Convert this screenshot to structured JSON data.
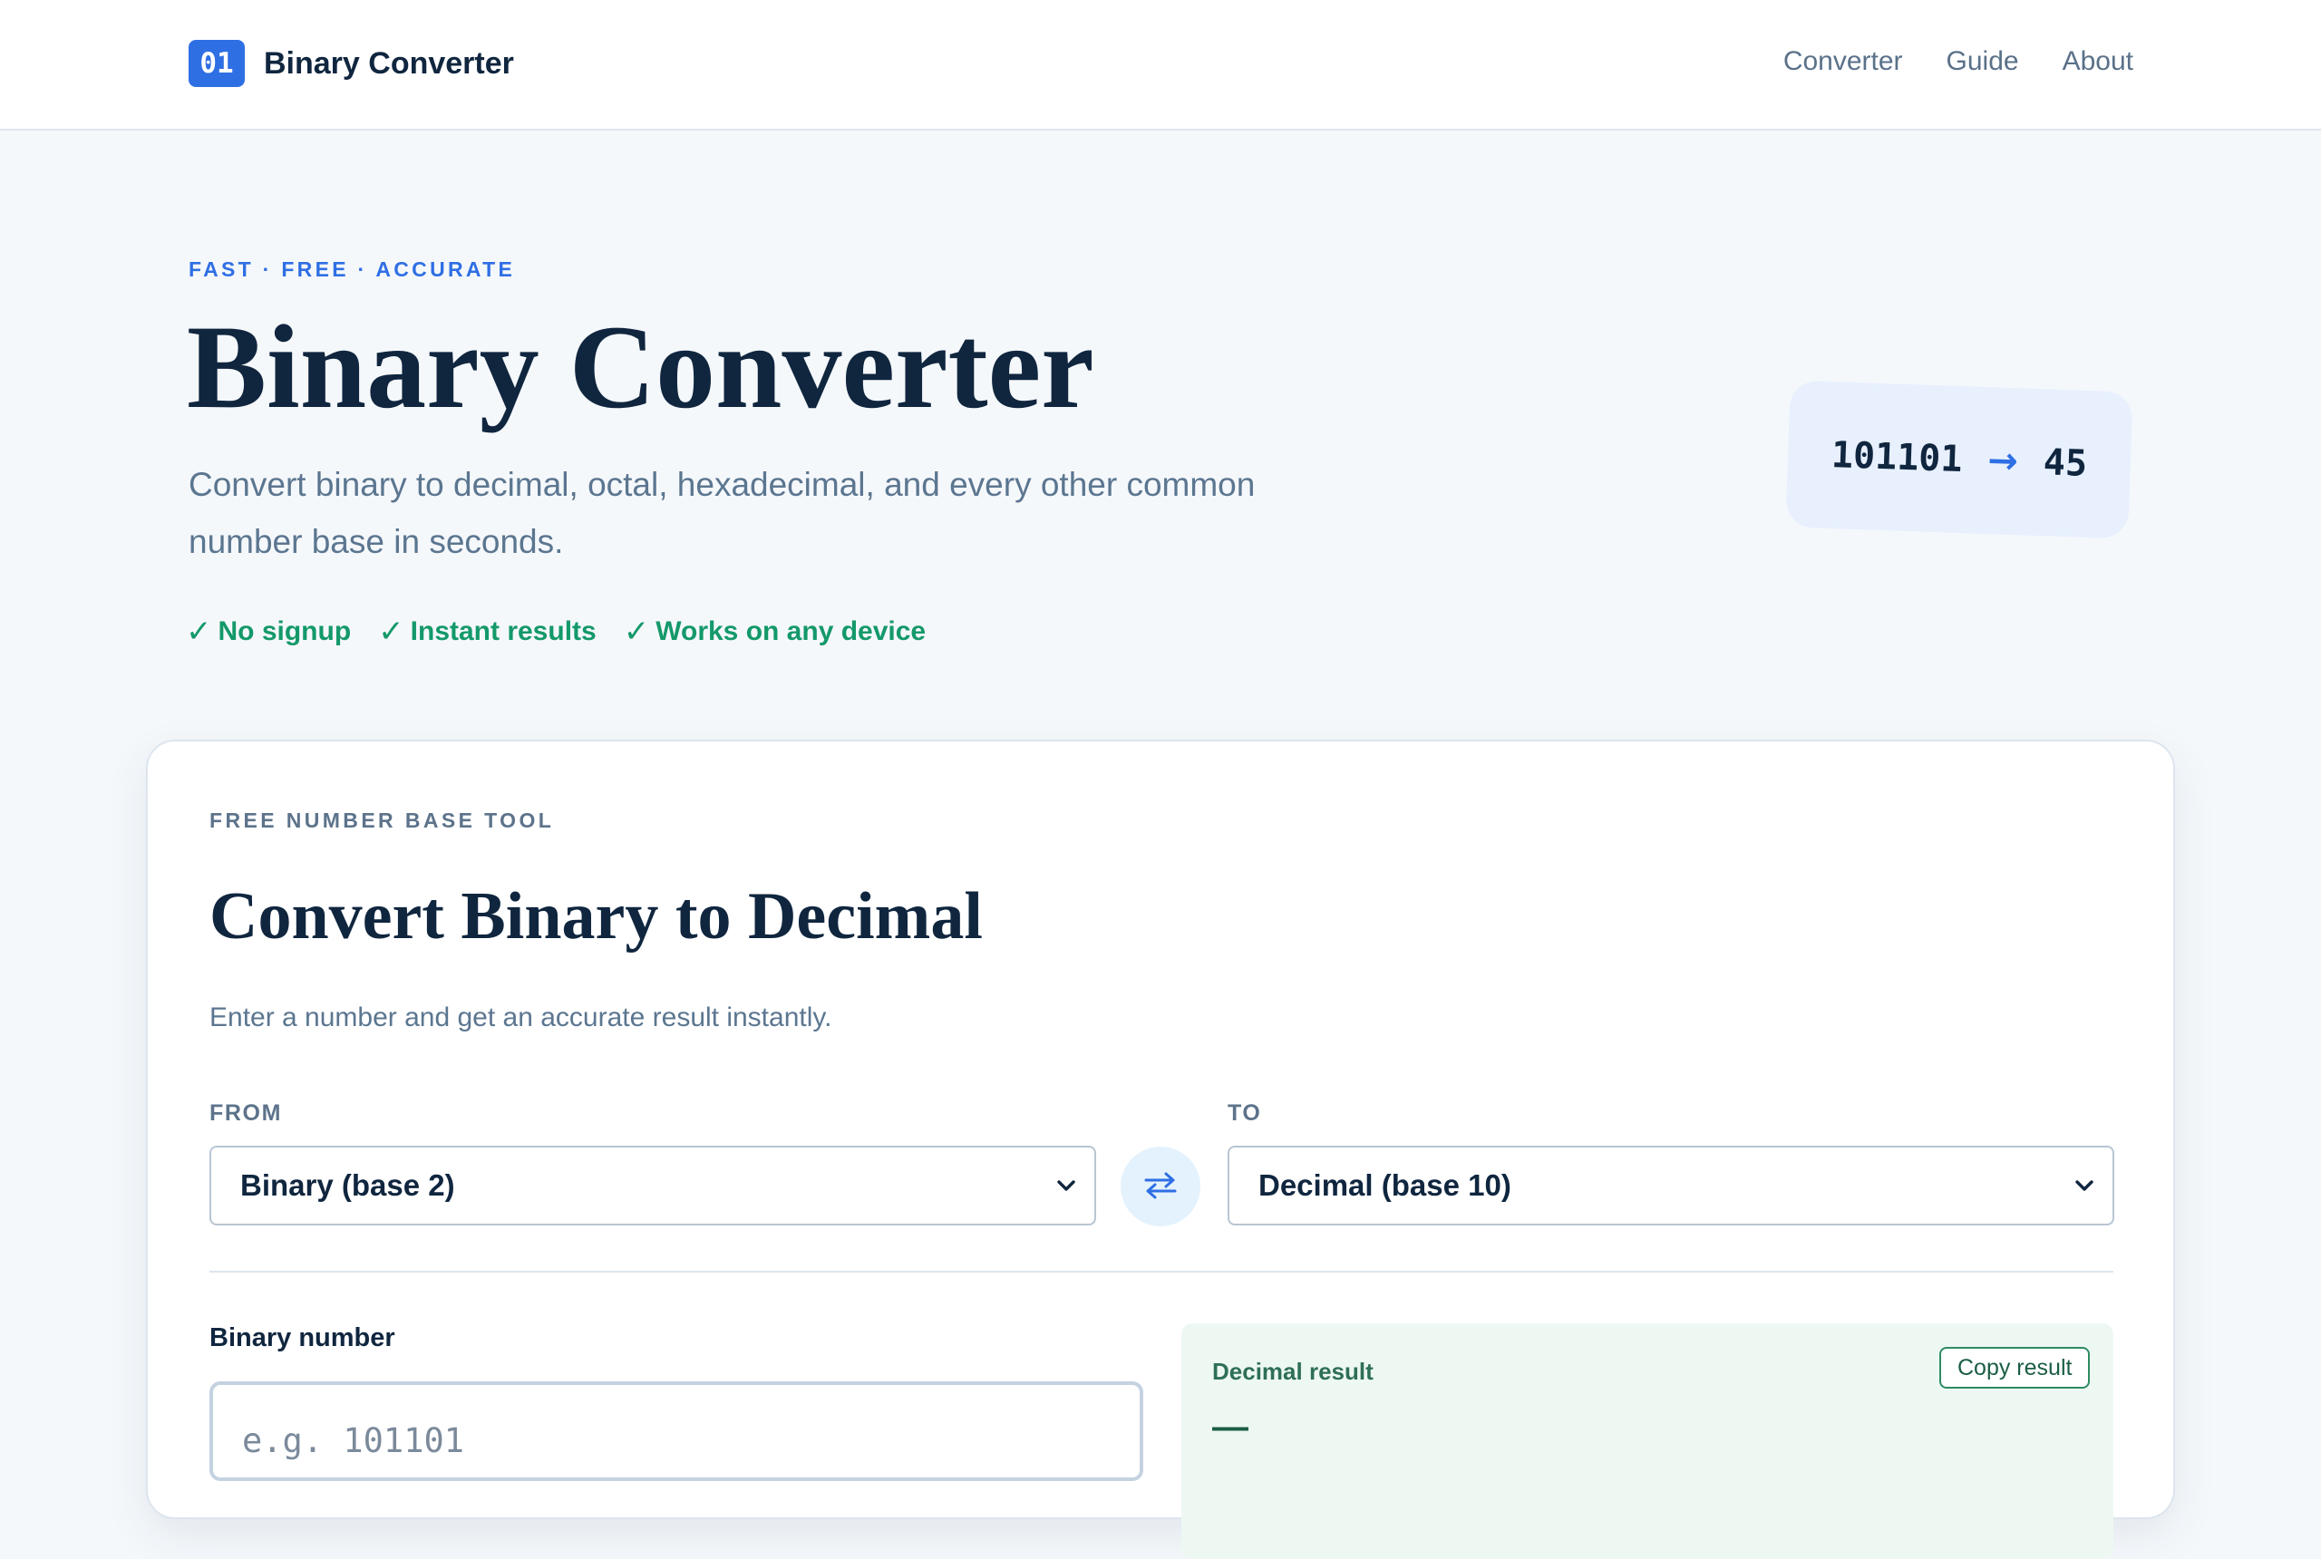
{
  "header": {
    "logo_text": "01",
    "brand_name": "Binary Converter",
    "nav": [
      {
        "label": "Converter"
      },
      {
        "label": "Guide"
      },
      {
        "label": "About"
      }
    ]
  },
  "hero": {
    "eyebrow": "FAST · FREE · ACCURATE",
    "title": "Binary Converter",
    "subtitle": "Convert binary to decimal, octal, hexadecimal, and every other common number base in seconds.",
    "features": [
      {
        "check": "✓",
        "label": "No signup"
      },
      {
        "check": "✓",
        "label": "Instant results"
      },
      {
        "check": "✓",
        "label": "Works on any device"
      }
    ],
    "badge": {
      "input": "101101",
      "arrow": "→",
      "output": "45"
    }
  },
  "converter": {
    "eyebrow": "FREE NUMBER BASE TOOL",
    "title": "Convert Binary to Decimal",
    "subtitle": "Enter a number and get an accurate result instantly.",
    "from_label": "FROM",
    "from_value": "Binary (base 2)",
    "to_label": "TO",
    "to_value": "Decimal (base 10)",
    "input_label": "Binary number",
    "input_placeholder": "e.g. 101101",
    "input_value": "",
    "result_label": "Decimal result",
    "copy_label": "Copy result",
    "result_value": "—"
  },
  "colors": {
    "accent": "#2f6fe4",
    "success": "#14996a",
    "text": "#10263f",
    "muted": "#5b7690",
    "background": "#f5f8fb"
  },
  "icons": {
    "features": "check-icon",
    "swap": "swap-arrows-icon",
    "select": "chevron-down-icon",
    "badge": "arrow-right-icon"
  }
}
